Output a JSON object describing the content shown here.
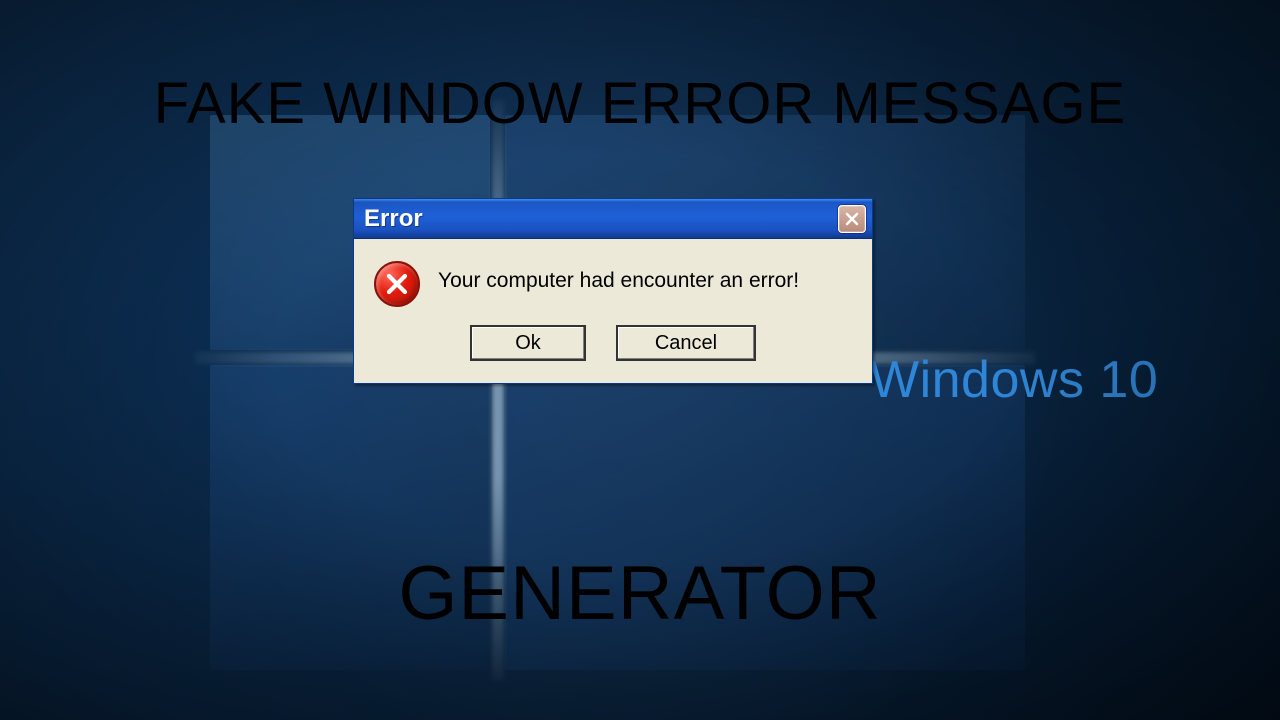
{
  "background": {
    "brand_text": "Windows 10",
    "brand_color": "#2f86d6"
  },
  "caption": {
    "top": "FAKE WINDOW ERROR MESSAGE",
    "bottom": "GENERATOR"
  },
  "dialog": {
    "title": "Error",
    "message": "Your computer had encounter an error!",
    "icon": "error-icon",
    "buttons": {
      "ok": "Ok",
      "cancel": "Cancel"
    }
  }
}
